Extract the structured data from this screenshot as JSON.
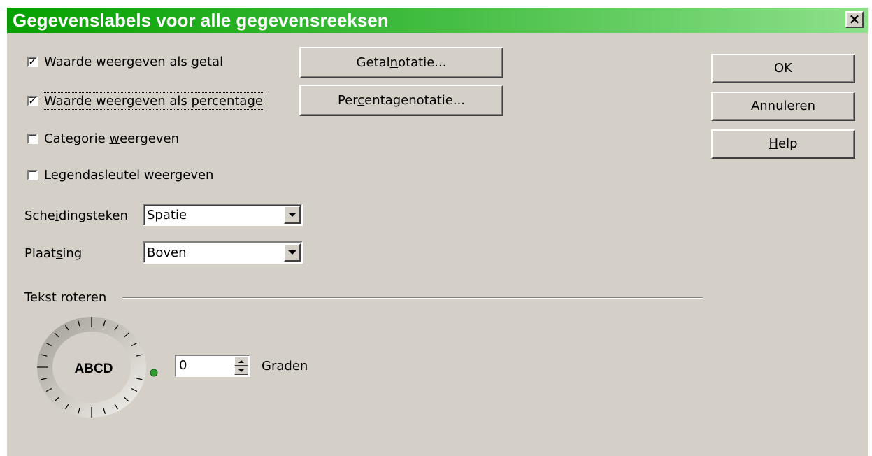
{
  "window": {
    "title": "Gegevenslabels voor alle gegevensreeksen",
    "close_label": "×"
  },
  "options": {
    "show_value_number": {
      "label_pre": "Waarde weergeven als ",
      "label_u": "g",
      "label_post": "etal",
      "checked": true
    },
    "show_value_percent": {
      "label_pre": "Waarde weergeven als ",
      "label_u": "p",
      "label_post": "ercentage",
      "checked": true
    },
    "show_category": {
      "label_pre": "Categorie ",
      "label_u": "w",
      "label_post": "eergeven",
      "checked": false
    },
    "show_legend_key": {
      "label_pre": "",
      "label_u": "L",
      "label_post": "egendasleutel weergeven",
      "checked": false
    }
  },
  "buttons": {
    "number_format": {
      "pre": "Getal",
      "u": "n",
      "post": "otatie..."
    },
    "percent_format": {
      "pre": "Per",
      "u": "c",
      "post": "entagenotatie..."
    },
    "ok": "OK",
    "cancel": "Annuleren",
    "help": {
      "pre": "",
      "u": "H",
      "post": "elp"
    }
  },
  "separator": {
    "label_pre": "Sche",
    "label_u": "i",
    "label_post": "dingsteken",
    "value": "Spatie"
  },
  "placement": {
    "label_pre": "Plaat",
    "label_u": "s",
    "label_post": "ing",
    "value": "Boven"
  },
  "rotate": {
    "group_label": "Tekst roteren",
    "dial_text": "ABCD",
    "degrees": "0",
    "unit_pre": "Gra",
    "unit_u": "d",
    "unit_post": "en"
  },
  "colors": {
    "title_start": "#06a000",
    "title_end": "#8ee08a",
    "dialog_bg": "#d4d0c8",
    "knob": "#2e9b2e"
  }
}
